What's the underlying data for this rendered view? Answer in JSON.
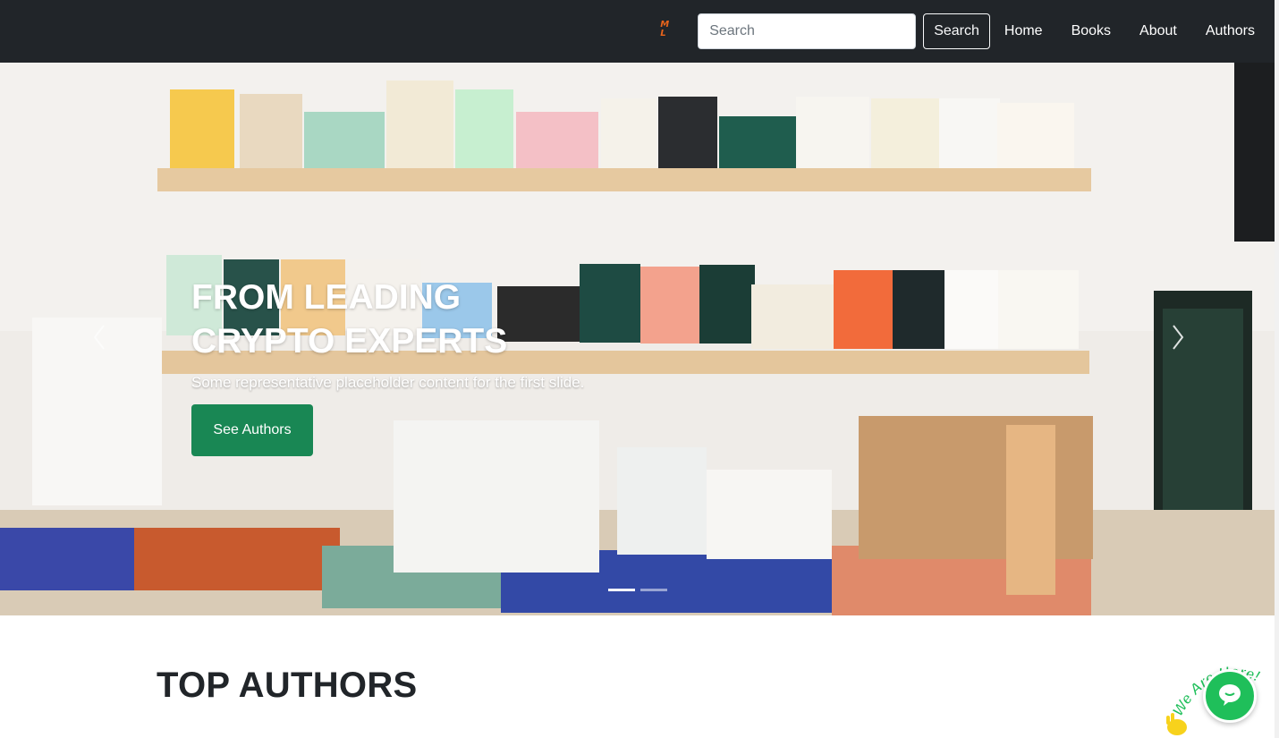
{
  "navbar": {
    "logo_text": "M L",
    "search": {
      "placeholder": "Search",
      "value": ""
    },
    "search_button_label": "Search",
    "links": [
      "Home",
      "Books",
      "About",
      "Authors"
    ]
  },
  "hero": {
    "title_line1": "FROM LEADING",
    "title_line2": "CRYPTO EXPERTS",
    "subtitle": "Some representative placeholder content for the first slide.",
    "cta_label": "See Authors",
    "slide_count": 2,
    "active_slide": 1,
    "cta_color": "#198754"
  },
  "section": {
    "title": "TOP AUTHORS"
  },
  "chat_widget": {
    "badge_text": "We Are Here!",
    "accent_color": "#1fbf5a"
  },
  "colors": {
    "navbar_bg": "#212529",
    "accent": "#198754"
  }
}
